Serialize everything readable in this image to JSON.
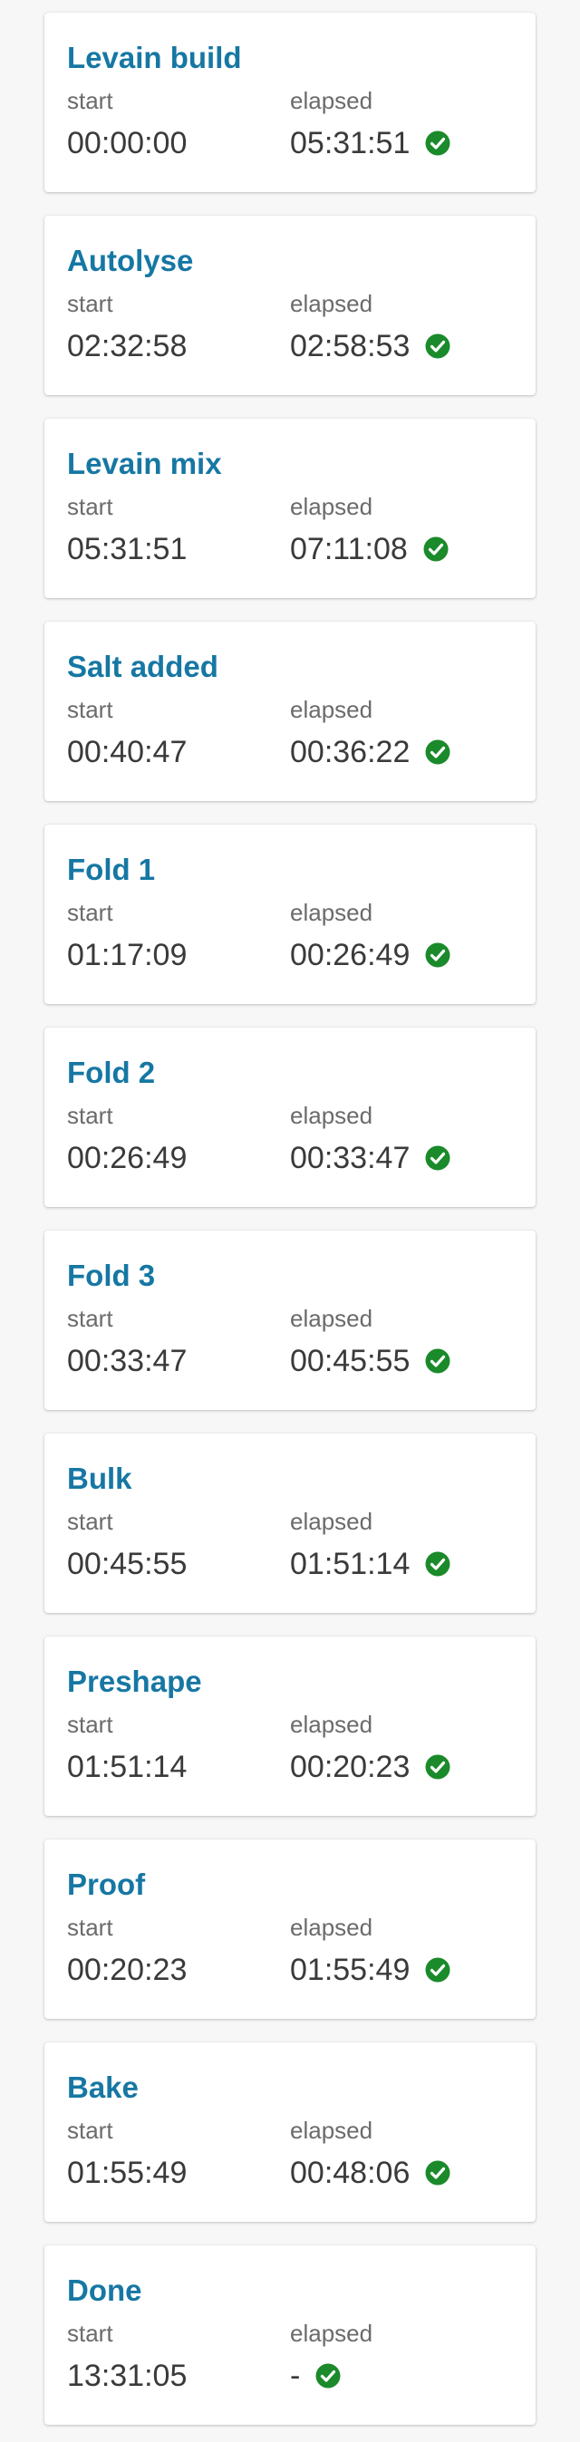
{
  "labels": {
    "start": "start",
    "elapsed": "elapsed"
  },
  "colors": {
    "title": "#1677a3",
    "check": "#1a8a2a"
  },
  "steps": [
    {
      "name": "Levain build",
      "start": "00:00:00",
      "elapsed": "05:31:51",
      "done_icon": "check-circle-icon"
    },
    {
      "name": "Autolyse",
      "start": "02:32:58",
      "elapsed": "02:58:53",
      "done_icon": "check-circle-icon"
    },
    {
      "name": "Levain mix",
      "start": "05:31:51",
      "elapsed": "07:11:08",
      "done_icon": "check-circle-icon"
    },
    {
      "name": "Salt added",
      "start": "00:40:47",
      "elapsed": "00:36:22",
      "done_icon": "check-circle-icon"
    },
    {
      "name": "Fold 1",
      "start": "01:17:09",
      "elapsed": "00:26:49",
      "done_icon": "check-circle-icon"
    },
    {
      "name": "Fold 2",
      "start": "00:26:49",
      "elapsed": "00:33:47",
      "done_icon": "check-circle-icon"
    },
    {
      "name": "Fold 3",
      "start": "00:33:47",
      "elapsed": "00:45:55",
      "done_icon": "check-circle-icon"
    },
    {
      "name": "Bulk",
      "start": "00:45:55",
      "elapsed": "01:51:14",
      "done_icon": "check-circle-icon"
    },
    {
      "name": "Preshape",
      "start": "01:51:14",
      "elapsed": "00:20:23",
      "done_icon": "check-circle-icon"
    },
    {
      "name": "Proof",
      "start": "00:20:23",
      "elapsed": "01:55:49",
      "done_icon": "check-circle-icon"
    },
    {
      "name": "Bake",
      "start": "01:55:49",
      "elapsed": "00:48:06",
      "done_icon": "check-circle-icon"
    },
    {
      "name": "Done",
      "start": "13:31:05",
      "elapsed": "-",
      "done_icon": "check-circle-icon"
    }
  ]
}
